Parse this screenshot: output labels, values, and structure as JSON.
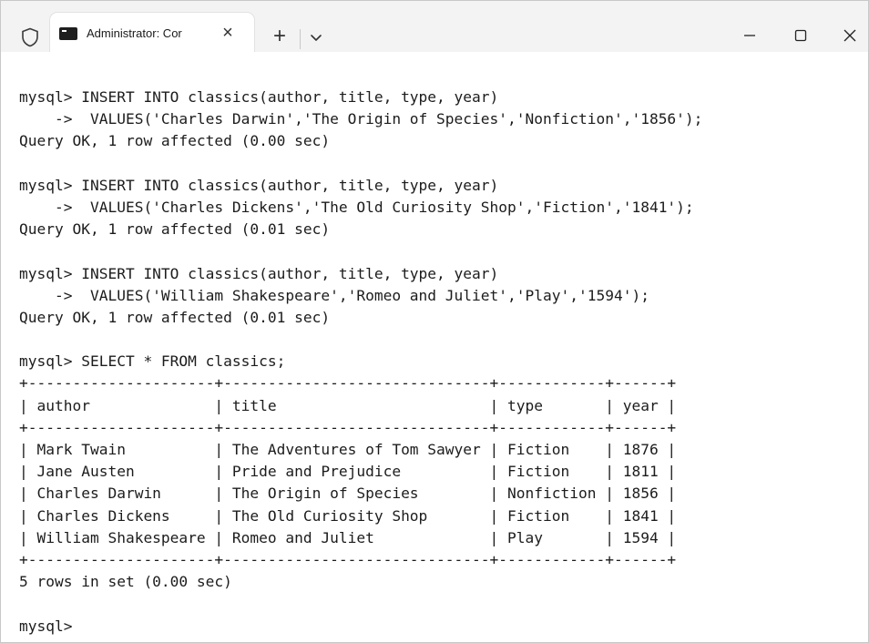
{
  "window": {
    "tab_title": "Administrator: Cor",
    "tab_close_glyph": "×",
    "new_tab_glyph": "+",
    "minimize_glyph": "—",
    "maximize_glyph": "☐",
    "close_glyph": "✕"
  },
  "icons": {
    "shield": "shield-icon",
    "terminal": "terminal-icon",
    "dropdown": "chevron-down-icon"
  },
  "terminal": {
    "lines": [
      "mysql> INSERT INTO classics(author, title, type, year)",
      "    ->  VALUES('Charles Darwin','The Origin of Species','Nonfiction','1856');",
      "Query OK, 1 row affected (0.00 sec)",
      "",
      "mysql> INSERT INTO classics(author, title, type, year)",
      "    ->  VALUES('Charles Dickens','The Old Curiosity Shop','Fiction','1841');",
      "Query OK, 1 row affected (0.01 sec)",
      "",
      "mysql> INSERT INTO classics(author, title, type, year)",
      "    ->  VALUES('William Shakespeare','Romeo and Juliet','Play','1594');",
      "Query OK, 1 row affected (0.01 sec)",
      "",
      "mysql> SELECT * FROM classics;",
      "+---------------------+------------------------------+------------+------+",
      "| author              | title                        | type       | year |",
      "+---------------------+------------------------------+------------+------+",
      "| Mark Twain          | The Adventures of Tom Sawyer | Fiction    | 1876 |",
      "| Jane Austen         | Pride and Prejudice          | Fiction    | 1811 |",
      "| Charles Darwin      | The Origin of Species        | Nonfiction | 1856 |",
      "| Charles Dickens     | The Old Curiosity Shop       | Fiction    | 1841 |",
      "| William Shakespeare | Romeo and Juliet             | Play       | 1594 |",
      "+---------------------+------------------------------+------------+------+",
      "5 rows in set (0.00 sec)",
      "",
      "mysql>"
    ]
  }
}
